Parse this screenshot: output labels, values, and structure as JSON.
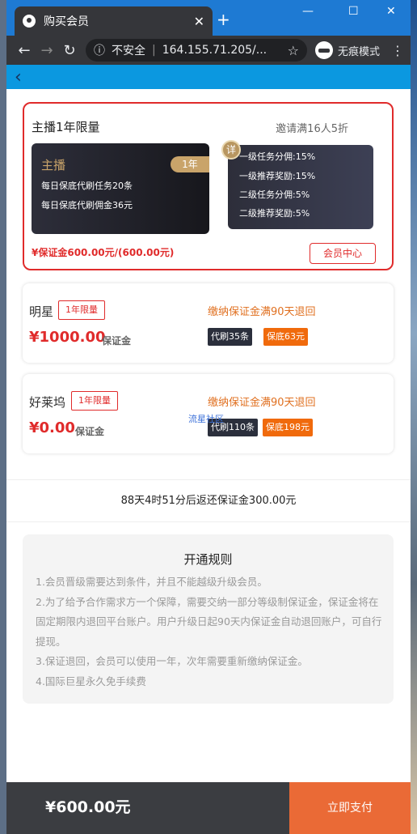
{
  "browser": {
    "tab_title": "购买会员",
    "tab_close": "✕",
    "new_tab": "+",
    "insecure_label": "不安全",
    "url": "164.155.71.205/...",
    "incognito_label": "无痕模式"
  },
  "current_plan": {
    "title": "主播1年限量",
    "invite_text": "邀请满16人5折",
    "card_name": "主播",
    "duration_badge": "1年",
    "daily_tasks": "每日保底代刷任务20条",
    "daily_commission": "每日保底代刷佣金36元",
    "info_icon_label": "详",
    "benefits": [
      "一级任务分佣:15%",
      "一级推荐奖励:15%",
      "二级任务分佣:5%",
      "二级推荐奖励:5%"
    ],
    "deposit": "¥保证金600.00元/(600.00元)",
    "member_center_button": "会员中心"
  },
  "plans": [
    {
      "name": "明星",
      "badge": "1年限量",
      "price": "¥1000.00",
      "price_label": "保证金",
      "refund": "缴纳保证金满90天退回",
      "tag_tasks": "代刷35条",
      "tag_guarantee": "保底63元"
    },
    {
      "name": "好莱坞",
      "badge": "1年限量",
      "price": "¥0.00",
      "price_label": "保证金",
      "refund": "缴纳保证金满90天退回",
      "tag_tasks": "代刷110条",
      "tag_guarantee": "保底198元"
    }
  ],
  "watermark": "流星社区",
  "countdown": "88天4时51分后返还保证金300.00元",
  "rules": {
    "title": "开通规则",
    "items": [
      "1.会员晋级需要达到条件，并且不能越级升级会员。",
      "2.为了给予合作需求方一个保障，需要交纳一部分等级制保证金，保证金将在固定期限内退回平台账户。用户升级日起90天内保证金自动退回账户，可自行提现。",
      "3.保证退回，会员可以使用一年，次年需要重新缴纳保证金。",
      "4.国际巨星永久免手续费"
    ]
  },
  "footer": {
    "total": "¥600.00元",
    "pay_button": "立即支付"
  }
}
